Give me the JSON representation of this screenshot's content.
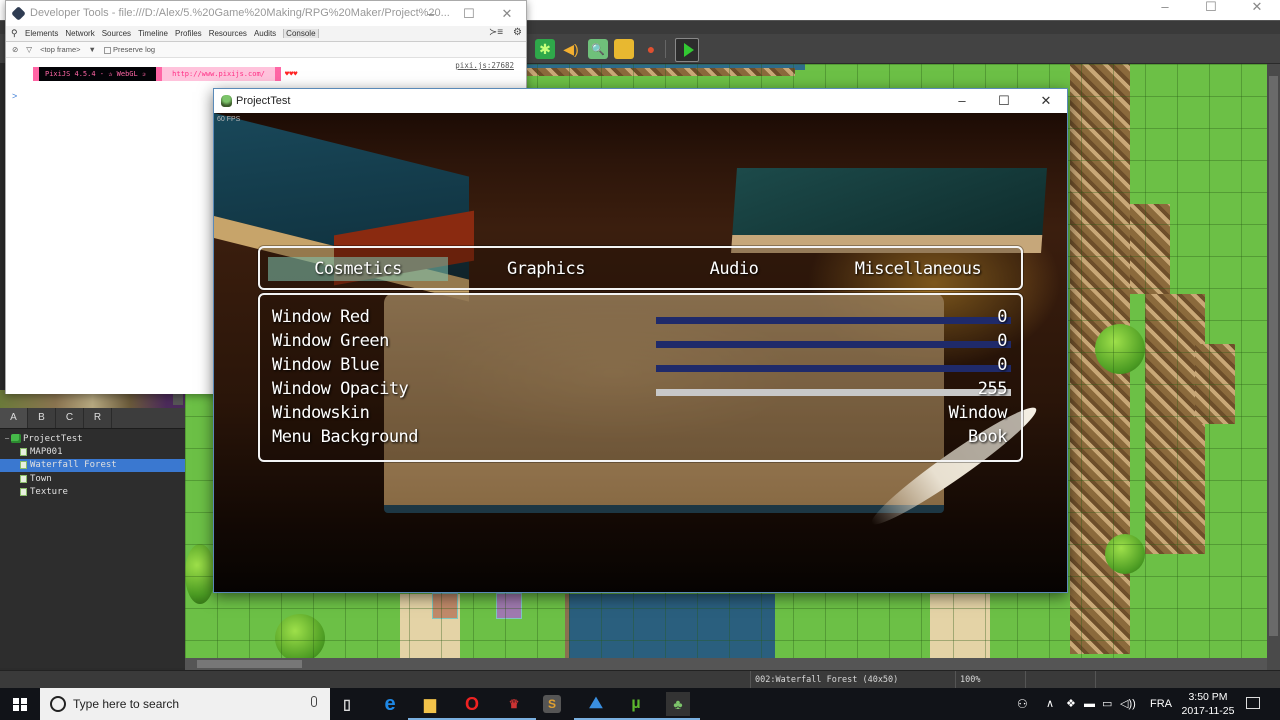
{
  "editor": {
    "window_controls": [
      "–",
      "☐",
      "✕"
    ],
    "toolbar_icons": [
      "plugin-manager-icon",
      "sound-test-icon",
      "event-searcher-icon",
      "resource-manager-icon",
      "character-generator-icon"
    ],
    "playtest_icon": "play-icon",
    "tileset_tabs": [
      "A",
      "B",
      "C",
      "R"
    ],
    "map_tree": {
      "project": "ProjectTest",
      "maps": [
        {
          "name": "MAP001",
          "selected": false
        },
        {
          "name": "Waterfall Forest",
          "selected": true
        },
        {
          "name": "Town",
          "selected": false
        },
        {
          "name": "Texture",
          "selected": false
        }
      ]
    },
    "status": {
      "map": "002:Waterfall Forest (40x50)",
      "zoom": "100%"
    }
  },
  "devtools": {
    "title": "Developer Tools - file:///D:/Alex/5.%20Game%20Making/RPG%20Maker/Project%20...",
    "window_controls": [
      "–",
      "☐",
      "✕"
    ],
    "tabs": [
      "Elements",
      "Network",
      "Sources",
      "Timeline",
      "Profiles",
      "Resources",
      "Audits",
      "Console"
    ],
    "active_tab": "Console",
    "toolbar": {
      "frame_select": "<top frame>",
      "preserve_log": "Preserve log",
      "preserve_log_checked": false
    },
    "console": {
      "pixi_label": "PixiJS 4.5.4 - ✰ WebGL ✰",
      "pixi_url": "http://www.pixijs.com/",
      "hearts": "♥♥♥",
      "source": "pixi.js:27682",
      "prompt": ">"
    }
  },
  "game": {
    "title": "ProjectTest",
    "window_controls": [
      "–",
      "☐",
      "✕"
    ],
    "fps": "60 FPS",
    "categories": [
      {
        "label": "Cosmetics",
        "active": true
      },
      {
        "label": "Graphics",
        "active": false
      },
      {
        "label": "Audio",
        "active": false
      },
      {
        "label": "Miscellaneous",
        "active": false
      }
    ],
    "options": [
      {
        "label": "Window Red",
        "value": "0",
        "gauge": 0.0
      },
      {
        "label": "Window Green",
        "value": "0",
        "gauge": 0.0
      },
      {
        "label": "Window Blue",
        "value": "0",
        "gauge": 0.0
      },
      {
        "label": "Window Opacity",
        "value": "255",
        "gauge": 1.0
      },
      {
        "label": "Windowskin",
        "value": "Window",
        "gauge": null
      },
      {
        "label": "Menu Background",
        "value": "Book",
        "gauge": null
      }
    ],
    "gauge_colors": {
      "track": "#1f2a6a",
      "fill": "#c8c8c8"
    },
    "active_tab_color": "#82c8b4"
  },
  "taskbar": {
    "search_placeholder": "Type here to search",
    "apps": [
      "task-view",
      "edge",
      "file-explorer",
      "opera",
      "rpg-maker-mv",
      "sublime-text",
      "nordvpn",
      "utorrent",
      "nwjs-game"
    ],
    "language": "FRA",
    "time": "3:50 PM",
    "date": "2017-11-25"
  }
}
